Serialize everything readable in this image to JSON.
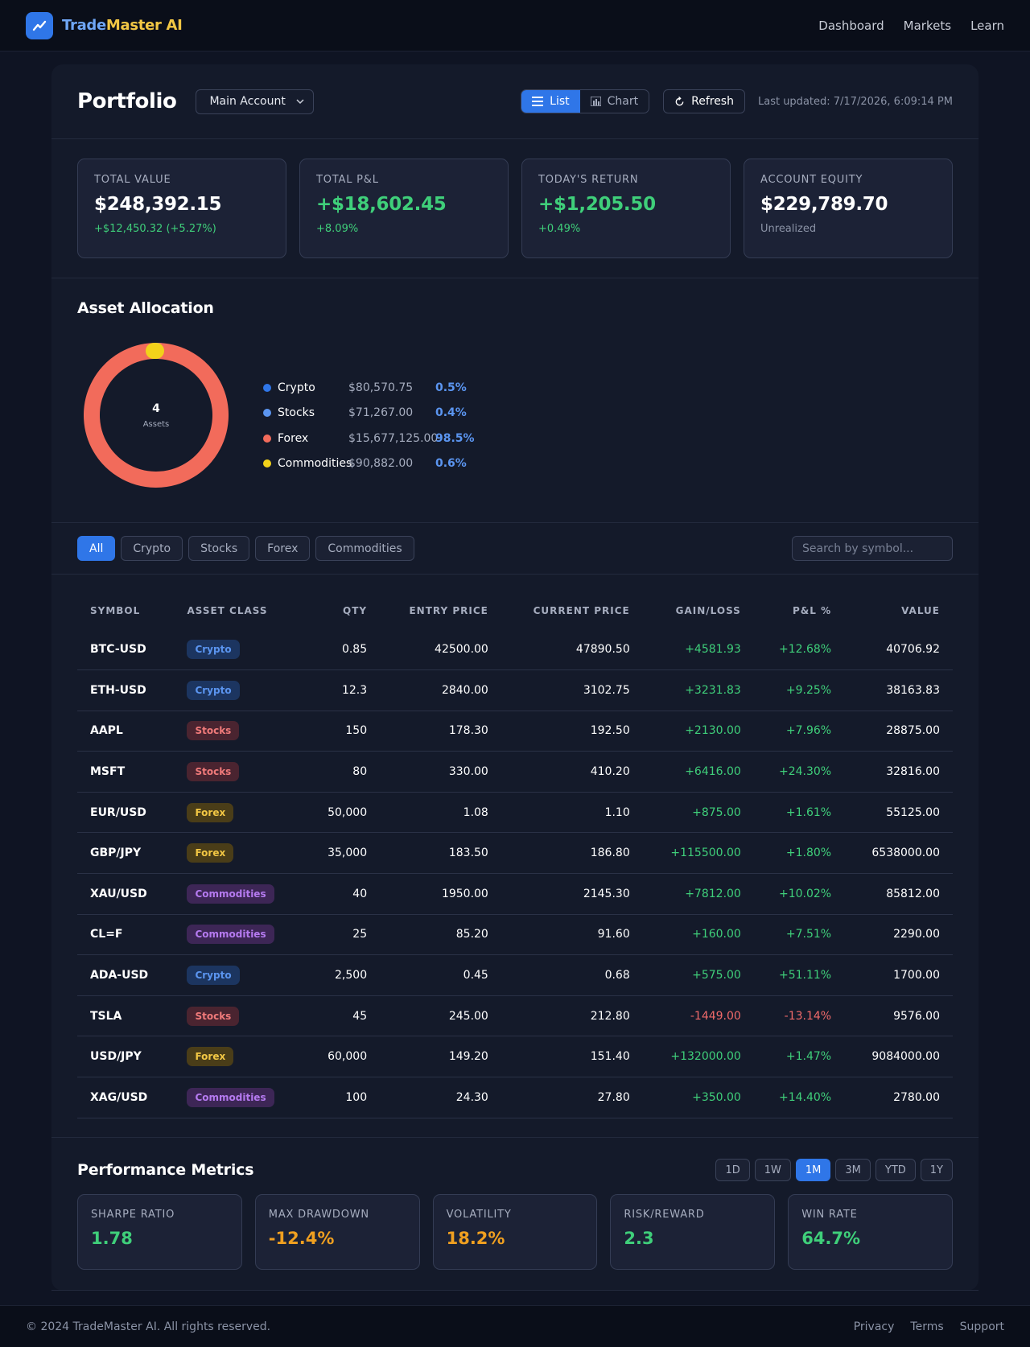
{
  "header": {
    "brand_part1": "Trade",
    "brand_part2": "Master AI",
    "nav": [
      "Dashboard",
      "Markets",
      "Learn"
    ]
  },
  "portfolio": {
    "title": "Portfolio",
    "account": "Main Account",
    "view_list": "List",
    "view_chart": "Chart",
    "refresh": "Refresh",
    "last_updated": "Last updated: 7/17/2026, 6:09:14 PM"
  },
  "summary": [
    {
      "label": "Total Value",
      "value": "$248,392.15",
      "sub": "+$12,450.32 (+5.27%)"
    },
    {
      "label": "Total P&L",
      "value": "+$18,602.45",
      "sub": "+8.09%"
    },
    {
      "label": "Today's Return",
      "value": "+$1,205.50",
      "sub": "+0.49%"
    },
    {
      "label": "Account Equity",
      "value": "$229,789.70",
      "sub": "Unrealized"
    }
  ],
  "allocation": {
    "title": "Asset Allocation",
    "center_count": "4",
    "center_label": "Assets",
    "items": [
      {
        "name": "Crypto",
        "value": "$80,570.75",
        "pct": "0.5%",
        "fraction": 0.005,
        "color": "#2f76e8"
      },
      {
        "name": "Stocks",
        "value": "$71,267.00",
        "pct": "0.4%",
        "fraction": 0.004,
        "color": "#5b95f0"
      },
      {
        "name": "Forex",
        "value": "$15,677,125.00",
        "pct": "98.5%",
        "fraction": 0.985,
        "color": "#f26b5b"
      },
      {
        "name": "Commodities",
        "value": "$90,882.00",
        "pct": "0.6%",
        "fraction": 0.006,
        "color": "#f2d21a"
      }
    ]
  },
  "filters": {
    "chips": [
      "All",
      "Crypto",
      "Stocks",
      "Forex",
      "Commodities"
    ],
    "search_placeholder": "Search by symbol..."
  },
  "table": {
    "headers": [
      "Symbol",
      "Asset Class",
      "Qty",
      "Entry Price",
      "Current Price",
      "Gain/Loss",
      "P&L %",
      "Value"
    ],
    "rows": [
      {
        "symbol": "BTC-USD",
        "cls": "Crypto",
        "qty": "0.85",
        "entry": "42500.00",
        "current": "47890.50",
        "gain": "+4581.93",
        "pnl": "+12.68%",
        "value": "40706.92"
      },
      {
        "symbol": "ETH-USD",
        "cls": "Crypto",
        "qty": "12.3",
        "entry": "2840.00",
        "current": "3102.75",
        "gain": "+3231.83",
        "pnl": "+9.25%",
        "value": "38163.83"
      },
      {
        "symbol": "AAPL",
        "cls": "Stocks",
        "qty": "150",
        "entry": "178.30",
        "current": "192.50",
        "gain": "+2130.00",
        "pnl": "+7.96%",
        "value": "28875.00"
      },
      {
        "symbol": "MSFT",
        "cls": "Stocks",
        "qty": "80",
        "entry": "330.00",
        "current": "410.20",
        "gain": "+6416.00",
        "pnl": "+24.30%",
        "value": "32816.00"
      },
      {
        "symbol": "EUR/USD",
        "cls": "Forex",
        "qty": "50,000",
        "entry": "1.08",
        "current": "1.10",
        "gain": "+875.00",
        "pnl": "+1.61%",
        "value": "55125.00"
      },
      {
        "symbol": "GBP/JPY",
        "cls": "Forex",
        "qty": "35,000",
        "entry": "183.50",
        "current": "186.80",
        "gain": "+115500.00",
        "pnl": "+1.80%",
        "value": "6538000.00"
      },
      {
        "symbol": "XAU/USD",
        "cls": "Commodities",
        "qty": "40",
        "entry": "1950.00",
        "current": "2145.30",
        "gain": "+7812.00",
        "pnl": "+10.02%",
        "value": "85812.00"
      },
      {
        "symbol": "CL=F",
        "cls": "Commodities",
        "qty": "25",
        "entry": "85.20",
        "current": "91.60",
        "gain": "+160.00",
        "pnl": "+7.51%",
        "value": "2290.00"
      },
      {
        "symbol": "ADA-USD",
        "cls": "Crypto",
        "qty": "2,500",
        "entry": "0.45",
        "current": "0.68",
        "gain": "+575.00",
        "pnl": "+51.11%",
        "value": "1700.00"
      },
      {
        "symbol": "TSLA",
        "cls": "Stocks",
        "qty": "45",
        "entry": "245.00",
        "current": "212.80",
        "gain": "-1449.00",
        "pnl": "-13.14%",
        "value": "9576.00"
      },
      {
        "symbol": "USD/JPY",
        "cls": "Forex",
        "qty": "60,000",
        "entry": "149.20",
        "current": "151.40",
        "gain": "+132000.00",
        "pnl": "+1.47%",
        "value": "9084000.00"
      },
      {
        "symbol": "XAG/USD",
        "cls": "Commodities",
        "qty": "100",
        "entry": "24.30",
        "current": "27.80",
        "gain": "+350.00",
        "pnl": "+14.40%",
        "value": "2780.00"
      }
    ]
  },
  "performance": {
    "title": "Performance Metrics",
    "periods": [
      "1D",
      "1W",
      "1M",
      "3M",
      "YTD",
      "1Y"
    ],
    "active_period": "1M",
    "metrics": [
      {
        "label": "Sharpe Ratio",
        "value": "1.78",
        "tone": "green"
      },
      {
        "label": "Max Drawdown",
        "value": "-12.4%",
        "tone": "orange"
      },
      {
        "label": "Volatility",
        "value": "18.2%",
        "tone": "orange"
      },
      {
        "label": "Risk/Reward",
        "value": "2.3",
        "tone": "green"
      },
      {
        "label": "Win Rate",
        "value": "64.7%",
        "tone": "green"
      }
    ]
  },
  "footer": {
    "copyright": "© 2024 TradeMaster AI. All rights reserved.",
    "links": [
      "Privacy",
      "Terms",
      "Support"
    ]
  },
  "colors": {
    "accent": "#2f76e8",
    "positive": "#3fcf7a",
    "negative": "#f06a6a",
    "warning": "#f0a020"
  }
}
